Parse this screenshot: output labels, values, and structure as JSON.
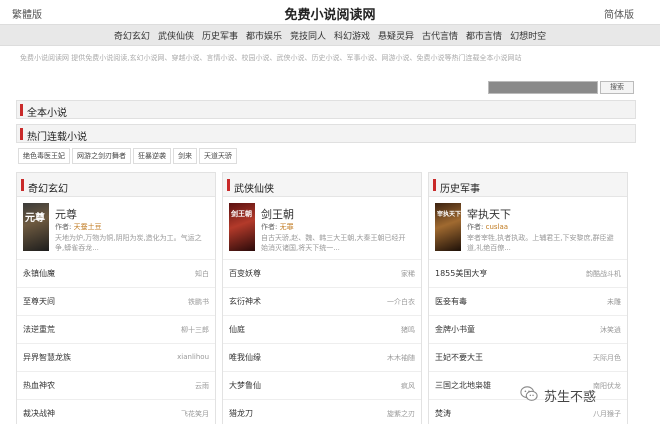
{
  "header": {
    "traditional_label": "繁體版",
    "title": "免费小说阅读网",
    "simplified_label": "简体版"
  },
  "nav": {
    "items": [
      "奇幻玄幻",
      "武侠仙侠",
      "历史军事",
      "都市娱乐",
      "竞技同人",
      "科幻游戏",
      "悬疑灵异",
      "古代言情",
      "都市言情",
      "幻想时空"
    ]
  },
  "description": "免费小说阅读网 提供免费小说阅读,玄幻小说网、穿越小说、言情小说、校园小说、武侠小说、历史小说、军事小说、网游小说、免费小说等热门连载全本小说网站",
  "search": {
    "placeholder": "",
    "button_label": "搜索"
  },
  "sections": {
    "complete_label": "全本小说",
    "hot_label": "热门连载小说"
  },
  "hot_tags": [
    "绝色毒医王妃",
    "网游之剑刃舞者",
    "狂暴逆袭",
    "剑来",
    "天道天骄"
  ],
  "columns": [
    {
      "heading": "奇幻玄幻",
      "featured": {
        "cover_text": "元尊",
        "title": "元尊",
        "author_label": "作者:",
        "author": "天蚕土豆",
        "desc": "天地为炉,万物为铜,阴阳为炭,造化为工。气运之争,蟒雀吞龙..."
      },
      "rows": [
        {
          "name": "永镇仙魔",
          "author": "知白"
        },
        {
          "name": "至尊天间",
          "author": "铁鹏书"
        },
        {
          "name": "法逆重荒",
          "author": "柳十三郎"
        },
        {
          "name": "异界智慧龙族",
          "author": "xianlihou"
        },
        {
          "name": "热血神农",
          "author": "云雨"
        },
        {
          "name": "裁决战神",
          "author": "飞花笑月"
        }
      ]
    },
    {
      "heading": "武侠仙侠",
      "featured": {
        "cover_text": "剑王朝",
        "title": "剑王朝",
        "author_label": "作者:",
        "author": "无罪",
        "desc": "自古天骄,赵、魏、韩三大王朝,大秦王朝已经开始消灭诸国,将天下统一..."
      },
      "rows": [
        {
          "name": "百变妖尊",
          "author": "家稀"
        },
        {
          "name": "玄衍神术",
          "author": "一介白衣"
        },
        {
          "name": "仙庭",
          "author": "猪鸣"
        },
        {
          "name": "唯我仙缘",
          "author": "木木袖随"
        },
        {
          "name": "大梦鲁仙",
          "author": "疯风"
        },
        {
          "name": "猎龙刀",
          "author": "旋紫之刃"
        }
      ]
    },
    {
      "heading": "历史军事",
      "featured": {
        "cover_text": "宰执天下",
        "title": "宰执天下",
        "author_label": "作者:",
        "author": "cuslaa",
        "desc": "宰者宰牲,执者执政。上辅君王,下安黎庶,群臣避道,礼绝百僚..."
      },
      "rows": [
        {
          "name": "1855美国大亨",
          "author": "韵酷战斗机"
        },
        {
          "name": "医妾有毒",
          "author": "未雕"
        },
        {
          "name": "金牌小书童",
          "author": "沐笑逍"
        },
        {
          "name": "王妃不要大王",
          "author": "天际月色"
        },
        {
          "name": "三国之北地枭雄",
          "author": "南阳伏龙"
        },
        {
          "name": "焚涛",
          "author": "八月猴子"
        }
      ]
    }
  ],
  "watermark": {
    "text": "苏生不惑"
  }
}
